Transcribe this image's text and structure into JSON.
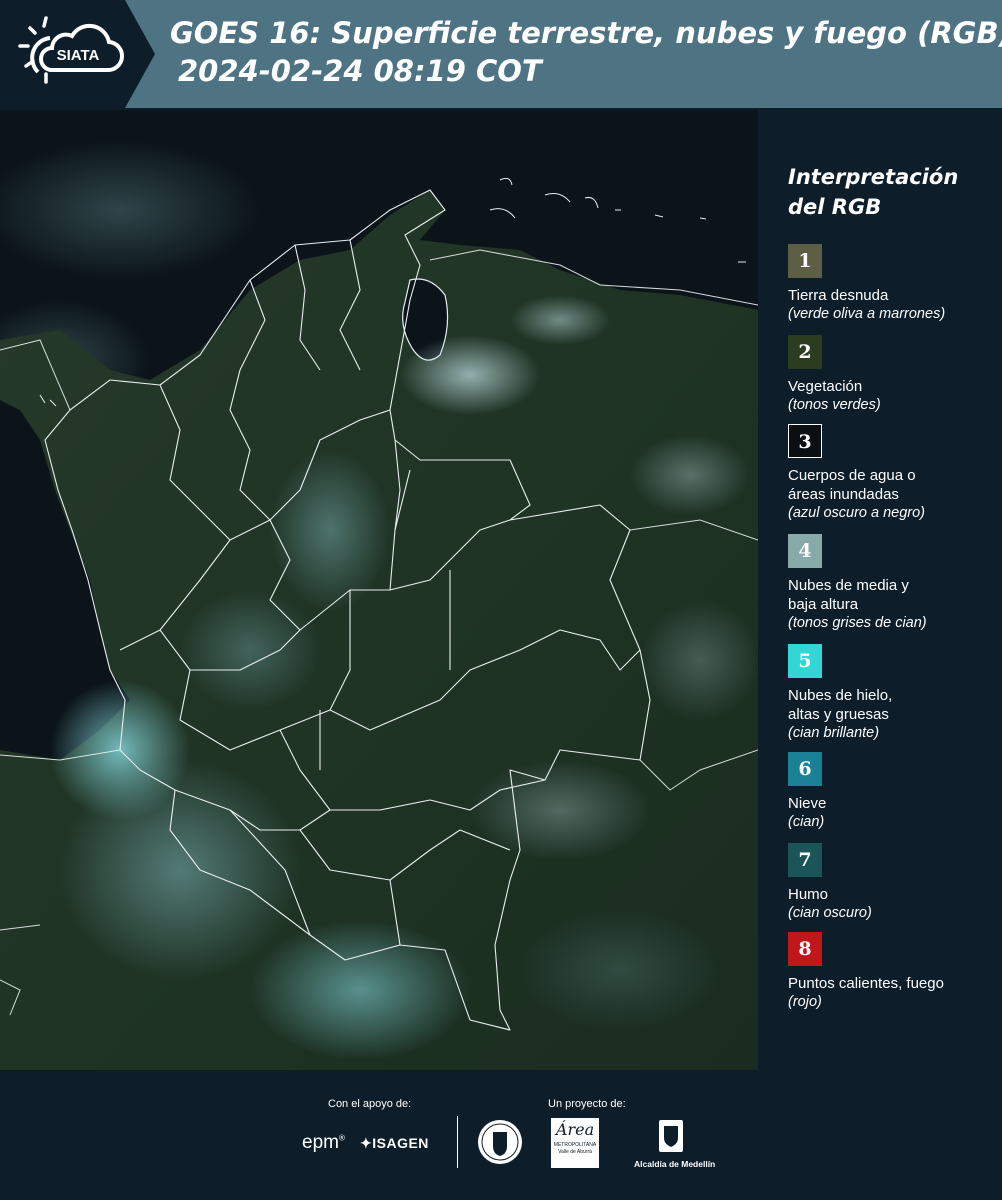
{
  "header": {
    "logo_text": "SIATA",
    "title_line1": "GOES 16: Superficie terrestre, nubes y fuego (RGB)",
    "title_line2": "2024-02-24 08:19 COT"
  },
  "legend": {
    "title_line1": "Interpretación",
    "title_line2": "del RGB",
    "items": [
      {
        "num": "1",
        "color": "#5e5e44",
        "label_lines": [
          "Tierra desnuda"
        ],
        "desc": "(verde oliva a marrones)"
      },
      {
        "num": "2",
        "color": "#2c3d1f",
        "label_lines": [
          "Vegetación"
        ],
        "desc": "(tonos verdes)"
      },
      {
        "num": "3",
        "color": "#0a0f14",
        "label_lines": [
          "Cuerpos de agua o",
          "áreas inundadas"
        ],
        "desc": "(azul oscuro a negro)"
      },
      {
        "num": "4",
        "color": "#86aaa8",
        "label_lines": [
          "Nubes de media y",
          "baja altura"
        ],
        "desc": "(tonos grises de cian)"
      },
      {
        "num": "5",
        "color": "#33d6d6",
        "label_lines": [
          "Nubes de hielo,",
          "altas y gruesas"
        ],
        "desc": "(cian brillante)"
      },
      {
        "num": "6",
        "color": "#1a8096",
        "label_lines": [
          "Nieve"
        ],
        "desc": "(cian)"
      },
      {
        "num": "7",
        "color": "#1c5558",
        "label_lines": [
          "Humo"
        ],
        "desc": "(cian oscuro)"
      },
      {
        "num": "8",
        "color": "#c0171a",
        "label_lines": [
          "Puntos calientes, fuego"
        ],
        "desc": "(rojo)"
      }
    ]
  },
  "footer": {
    "support_label": "Con el apoyo de:",
    "project_label": "Un proyecto de:",
    "brand_epm": "epm",
    "brand_isagen": "ISAGEN",
    "brand_area_1": "Área",
    "brand_area_2": "METROPOLITANA",
    "brand_area_3": "Valle de Aburrá",
    "brand_alcaldia": "Alcaldía de Medellín"
  },
  "colors": {
    "header_bg": "#4e7484",
    "page_bg": "#0d1e2a",
    "map_land": "#1f3323",
    "map_water": "#0b1216",
    "border_line": "#e8eef0"
  }
}
